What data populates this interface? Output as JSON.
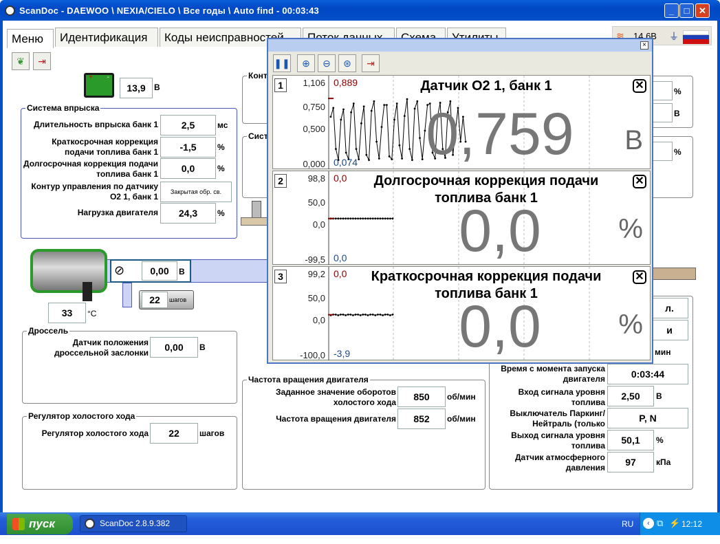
{
  "window": {
    "title": "ScanDoc - DAEWOO \\ NEXIA/CIELO \\ Все годы \\ Auto find - 00:03:43"
  },
  "tabs": [
    "Меню",
    "Идентификация",
    "Коды неисправностей",
    "Поток данных",
    "Схема",
    "Утилиты"
  ],
  "status": {
    "voltage": "14,6В"
  },
  "battery": {
    "value": "13,9",
    "unit": "В"
  },
  "injection": {
    "title": "Система впрыска",
    "rows": [
      {
        "label": "Длительность впрыска банк 1",
        "value": "2,5",
        "unit": "мс"
      },
      {
        "label": "Краткосрочная коррекция подачи топлива банк 1",
        "value": "-1,5",
        "unit": "%"
      },
      {
        "label": "Долгосрочная коррекция подачи топлива банк 1",
        "value": "0,0",
        "unit": "%"
      },
      {
        "label": "Контур управления по датчику О2 1, банк 1",
        "value": "Закрытая обр. св.",
        "unit": ""
      },
      {
        "label": "Нагрузка двигателя",
        "value": "24,3",
        "unit": "%"
      }
    ]
  },
  "hidden_groups": {
    "g1": "Контр",
    "g2": "Систе"
  },
  "right_top": {
    "u1": "%",
    "u2": "В",
    "u3": "%"
  },
  "throttle_valve": {
    "value": "0,00",
    "unit": "В"
  },
  "idle_steps": {
    "value": "22",
    "unit": "шагов"
  },
  "coolant": {
    "value": "33",
    "unit": "°С"
  },
  "throttle": {
    "title": "Дроссель",
    "label": "Датчик положения дроссельной заслонки",
    "value": "0,00",
    "unit": "В"
  },
  "idle": {
    "title": "Регулятор холостого хода",
    "label": "Регулятор холостого хода",
    "value": "22",
    "unit": "шагов"
  },
  "rpm": {
    "title": "Частота вращения двигателя",
    "rows": [
      {
        "label": "Заданное значение оборотов холостого хода",
        "value": "850",
        "unit": "об/мин"
      },
      {
        "label": "Частота вращения двигателя",
        "value": "852",
        "unit": "об/мин"
      }
    ]
  },
  "misc": {
    "partial1": "л.",
    "partial2": "и",
    "partial3": "мин",
    "rows": [
      {
        "label": "Время с момента запуска двигателя",
        "value": "0:03:44",
        "unit": ""
      },
      {
        "label": "Вход сигнала уровня топлива",
        "value": "2,50",
        "unit": "В"
      },
      {
        "label": "Выключатель Паркинг/Нейтраль (только",
        "value": "P, N",
        "unit": ""
      },
      {
        "label": "Выход сигнала уровня топлива",
        "value": "50,1",
        "unit": "%"
      },
      {
        "label": "Датчик атмосферного давления",
        "value": "97",
        "unit": "кПа"
      }
    ]
  },
  "graphs": [
    {
      "num": "1",
      "title": "Датчик О2 1, банк 1",
      "value": "0,759",
      "unit": "В",
      "ymax": "1,106",
      "ymid1": "0,750",
      "ymid2": "0,500",
      "ymin": "0,000",
      "peak_max": "0,889",
      "peak_min": "0,074",
      "samples": [
        0.64,
        0.76,
        0.2,
        0.05,
        0.6,
        0.74,
        0.15,
        0.06,
        0.7,
        0.82,
        0.2,
        0.06,
        0.55,
        0.78,
        0.12,
        0.05,
        0.72,
        0.85,
        0.3,
        0.07,
        0.5,
        0.8,
        0.8,
        0.1,
        0.06,
        0.6,
        0.82,
        0.25,
        0.07,
        0.65,
        0.88,
        0.2,
        0.05,
        0.75,
        0.85,
        0.35,
        0.06,
        0.45,
        0.8,
        0.82,
        0.15,
        0.07,
        0.65,
        0.83,
        0.2,
        0.08,
        0.7,
        0.85,
        0.12,
        0.45,
        0.76,
        0.3,
        0.64,
        0.3
      ]
    },
    {
      "num": "2",
      "title": "Долгосрочная коррекция подачи топлива банк 1",
      "value": "0,0",
      "unit": "%",
      "ymax": "98,8",
      "ymid1": "50,0",
      "ymid2": "0,0",
      "ymin": "-99,5",
      "peak_max": "0,0",
      "peak_min": "0,0",
      "flat_value": 0.0
    },
    {
      "num": "3",
      "title": "Краткосрочная коррекция подачи топлива банк 1",
      "value": "0,0",
      "unit": "%",
      "ymax": "99,2",
      "ymid1": "50,0",
      "ymid2": "0,0",
      "ymin": "-100,0",
      "peak_max": "0,0",
      "peak_min": "-3,9",
      "flat_value": -1.5
    }
  ],
  "taskbar": {
    "start": "пуск",
    "app": "ScanDoc 2.8.9.382",
    "lang": "RU",
    "clock": "12:12"
  },
  "colors": {
    "accent": "#0047c4",
    "group_border": "#4a5ac0",
    "engine_green": "#2a9a2a"
  }
}
